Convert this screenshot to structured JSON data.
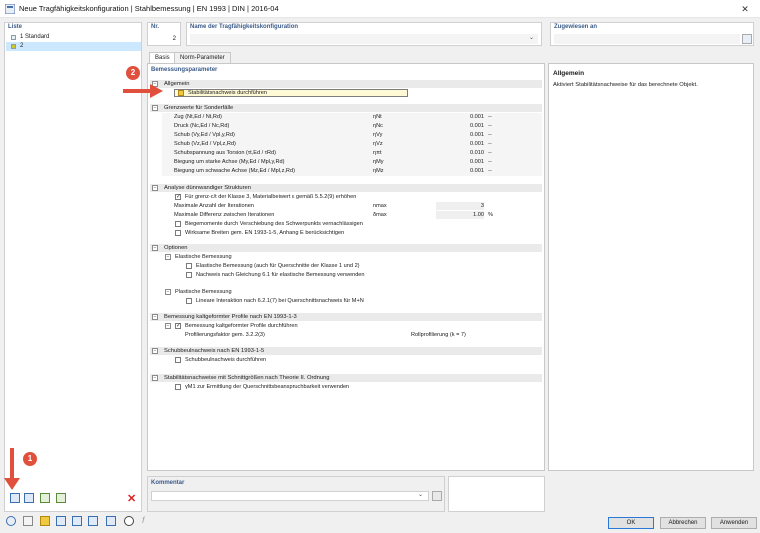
{
  "window": {
    "title": "Neue Tragfähigkeitskonfiguration | Stahlbemessung | EN 1993 | DIN | 2016-04"
  },
  "list": {
    "header": "Liste",
    "items": [
      {
        "num": "1",
        "label": "Standard",
        "color": "#dff3fb"
      },
      {
        "num": "2",
        "label": "",
        "color": "#c8c832"
      }
    ]
  },
  "nr": {
    "label": "Nr.",
    "value": "2"
  },
  "name": {
    "label": "Name der Tragfähigkeitskonfiguration",
    "value": ""
  },
  "assigned": {
    "label": "Zugewiesen an",
    "value": ""
  },
  "tabs": [
    {
      "label": "Basis",
      "active": true
    },
    {
      "label": "Norm-Parameter",
      "active": false
    }
  ],
  "params": {
    "header": "Bemessungsparameter",
    "general": {
      "title": "Allgemein",
      "stability_label": "Stabilitätsnachweis durchführen"
    },
    "limits": {
      "title": "Grenzwerte für Sonderfälle",
      "rows": [
        {
          "label": "Zug (Nt,Ed / Nt,Rd)",
          "symbol": "ηNt",
          "value": "0.001",
          "unit": "--"
        },
        {
          "label": "Druck (Nc,Ed / Nc,Rd)",
          "symbol": "ηNc",
          "value": "0.001",
          "unit": "--"
        },
        {
          "label": "Schub (Vy,Ed / Vpl,y,Rd)",
          "symbol": "ηVy",
          "value": "0.001",
          "unit": "--"
        },
        {
          "label": "Schub (Vz,Ed / Vpl,z,Rd)",
          "symbol": "ηVz",
          "value": "0.001",
          "unit": "--"
        },
        {
          "label": "Schubspannung aus Torsion (τt,Ed / τRd)",
          "symbol": "ηπt",
          "value": "0.010",
          "unit": "--"
        },
        {
          "label": "Biegung um starke Achse (My,Ed / Mpl,y,Rd)",
          "symbol": "ηMy",
          "value": "0.001",
          "unit": "--"
        },
        {
          "label": "Biegung um schwache Achse (Mz,Ed / Mpl,z,Rd)",
          "symbol": "ηMz",
          "value": "0.001",
          "unit": "--"
        }
      ]
    },
    "thin": {
      "title": "Analyse dünnwandiger Strukturen",
      "grenz_label": "Für grenz-c/t der Klasse 3, Materialbeiwert ε gemäß 5.5.2(9) erhöhen",
      "iter_label": "Maximale Anzahl der Iterationen",
      "iter_symbol": "nmax",
      "iter_value": "3",
      "diff_label": "Maximale Differenz zwischen Iterationen",
      "diff_symbol": "δmax",
      "diff_value": "1.00",
      "diff_unit": "%",
      "bending_label": "Biegemomente durch Verschiebung des Schwerpunkts vernachlässigen",
      "eff_label": "Wirksame Breiten gem. EN 1993-1-5, Anhang E berücksichtigen"
    },
    "options": {
      "title": "Optionen",
      "elastic_title": "Elastische Bemessung",
      "elastic_cb1": "Elastische Bemessung (auch für Querschnitte der Klasse 1 und 2)",
      "elastic_cb2": "Nachweis nach Gleichung 6.1 für elastische Bemessung verwenden",
      "plastic_title": "Plastische Bemessung",
      "plastic_cb1": "Lineare Interaktion nach 6.2.1(7) bei Querschnittsnachweis für M+N"
    },
    "cold": {
      "title": "Bemessung kaltgeformter Profile nach EN 1993-1-3",
      "cb_label": "Bemessung kaltgeformter Profile durchführen",
      "factor_label": "Profilierungsfaktor gem. 3.2.2(3)",
      "factor_value": "Rollprofilierung (k = 7)"
    },
    "shear": {
      "title": "Schubbeulnachweis nach EN 1993-1-5",
      "cb_label": "Schubbeulnachweis durchführen"
    },
    "stab2": {
      "title": "Stabilitätsnachweise mit Schnittgrößen nach Theorie II. Ordnung",
      "cb_label": "γM1 zur Ermittlung der Querschnittsbeanspruchbarkeit verwenden"
    }
  },
  "info": {
    "title": "Allgemein",
    "text": "Aktiviert Stabilitätsnachweise für das berechnete Objekt."
  },
  "comment": {
    "label": "Kommentar",
    "value": ""
  },
  "buttons": {
    "ok": "OK",
    "cancel": "Abbrechen",
    "apply": "Anwenden"
  },
  "markers": {
    "one": "1",
    "two": "2",
    "arrow_color": "#e0503c"
  },
  "accent": "#2a78d6"
}
